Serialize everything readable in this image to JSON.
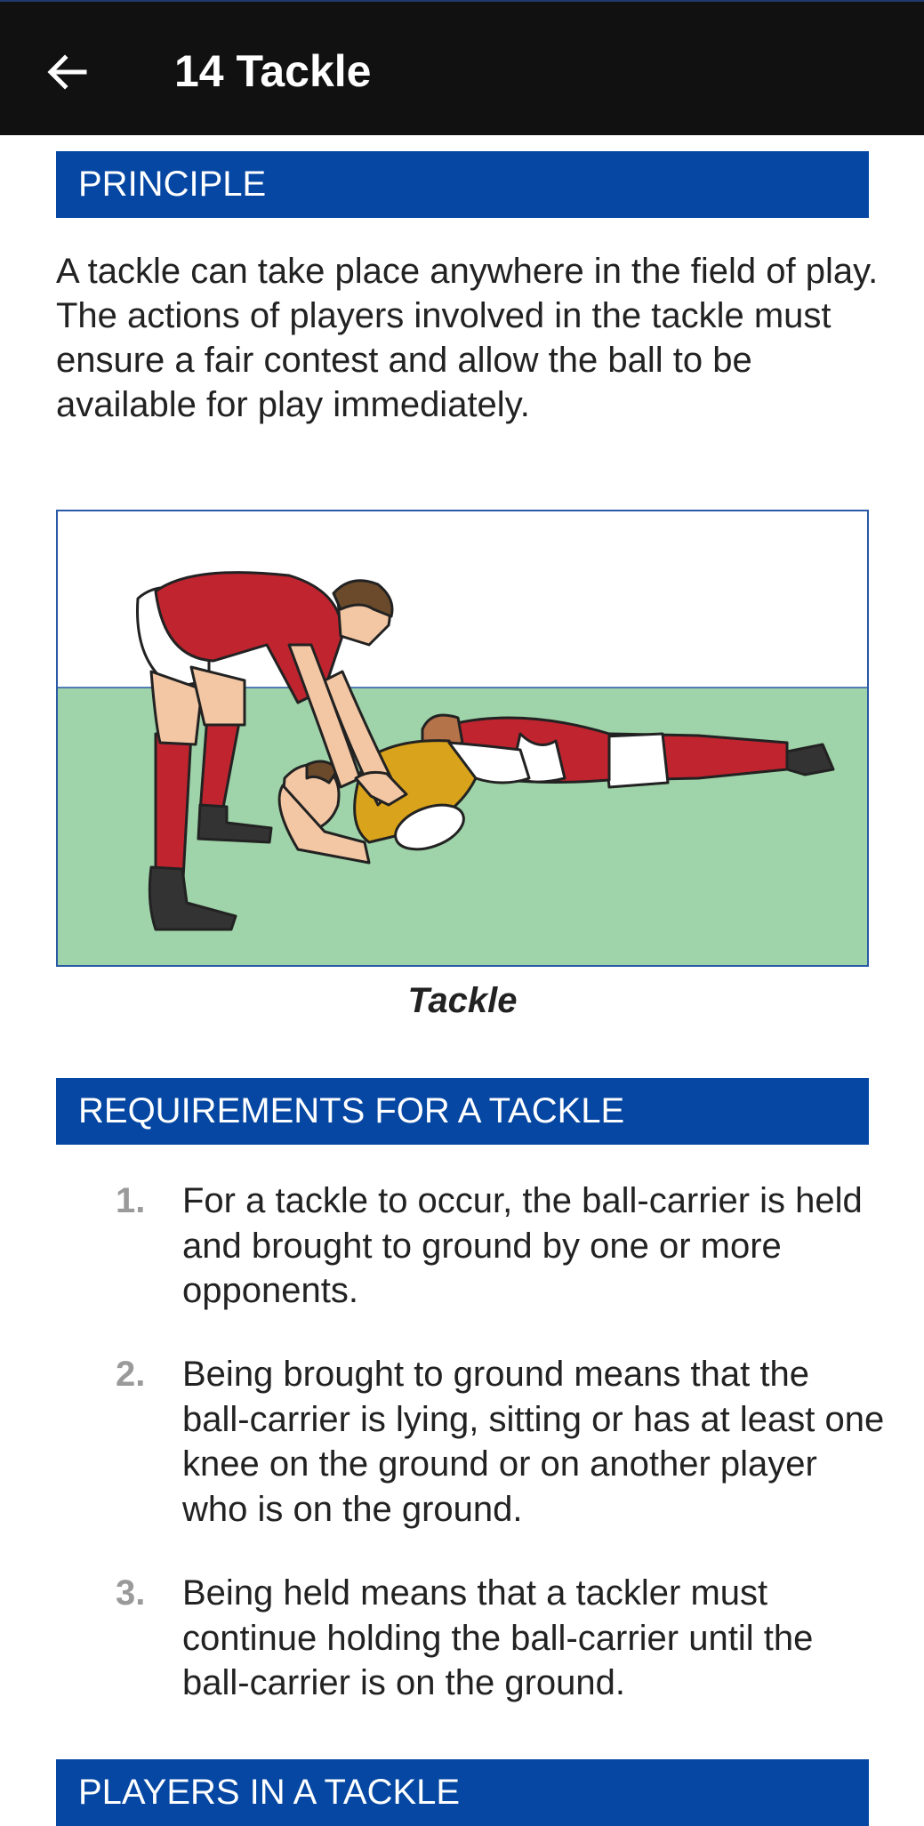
{
  "appbar": {
    "back_icon": "arrow-left-icon",
    "title": "14 Tackle"
  },
  "principle": {
    "heading": "PRINCIPLE",
    "text": "A tackle can take place anywhere in the field of play. The actions of players involved in the tackle must ensure a fair contest and allow the ball to be available for play immediately."
  },
  "figure": {
    "caption": "Tackle",
    "colors": {
      "pitch": "#9fd3a9",
      "red_kit": "#c0242f",
      "yellow_kit": "#d9a31b"
    }
  },
  "requirements": {
    "heading": "REQUIREMENTS FOR A TACKLE",
    "items": [
      {
        "number": "1.",
        "text": "For a tackle to occur, the ball-carrier is held and brought to ground by one or more opponents."
      },
      {
        "number": "2.",
        "text": "Being brought to ground means that the ball-carrier is lying, sitting or has at least one knee on the ground or on another player who is on the ground."
      },
      {
        "number": "3.",
        "text": "Being held means that a tackler must continue holding the ball-carrier until the ball-carrier is on the ground."
      }
    ]
  },
  "players": {
    "heading": "PLAYERS IN A TACKLE"
  },
  "theme": {
    "header_bg": "#111111",
    "section_blue": "#0547a3"
  }
}
